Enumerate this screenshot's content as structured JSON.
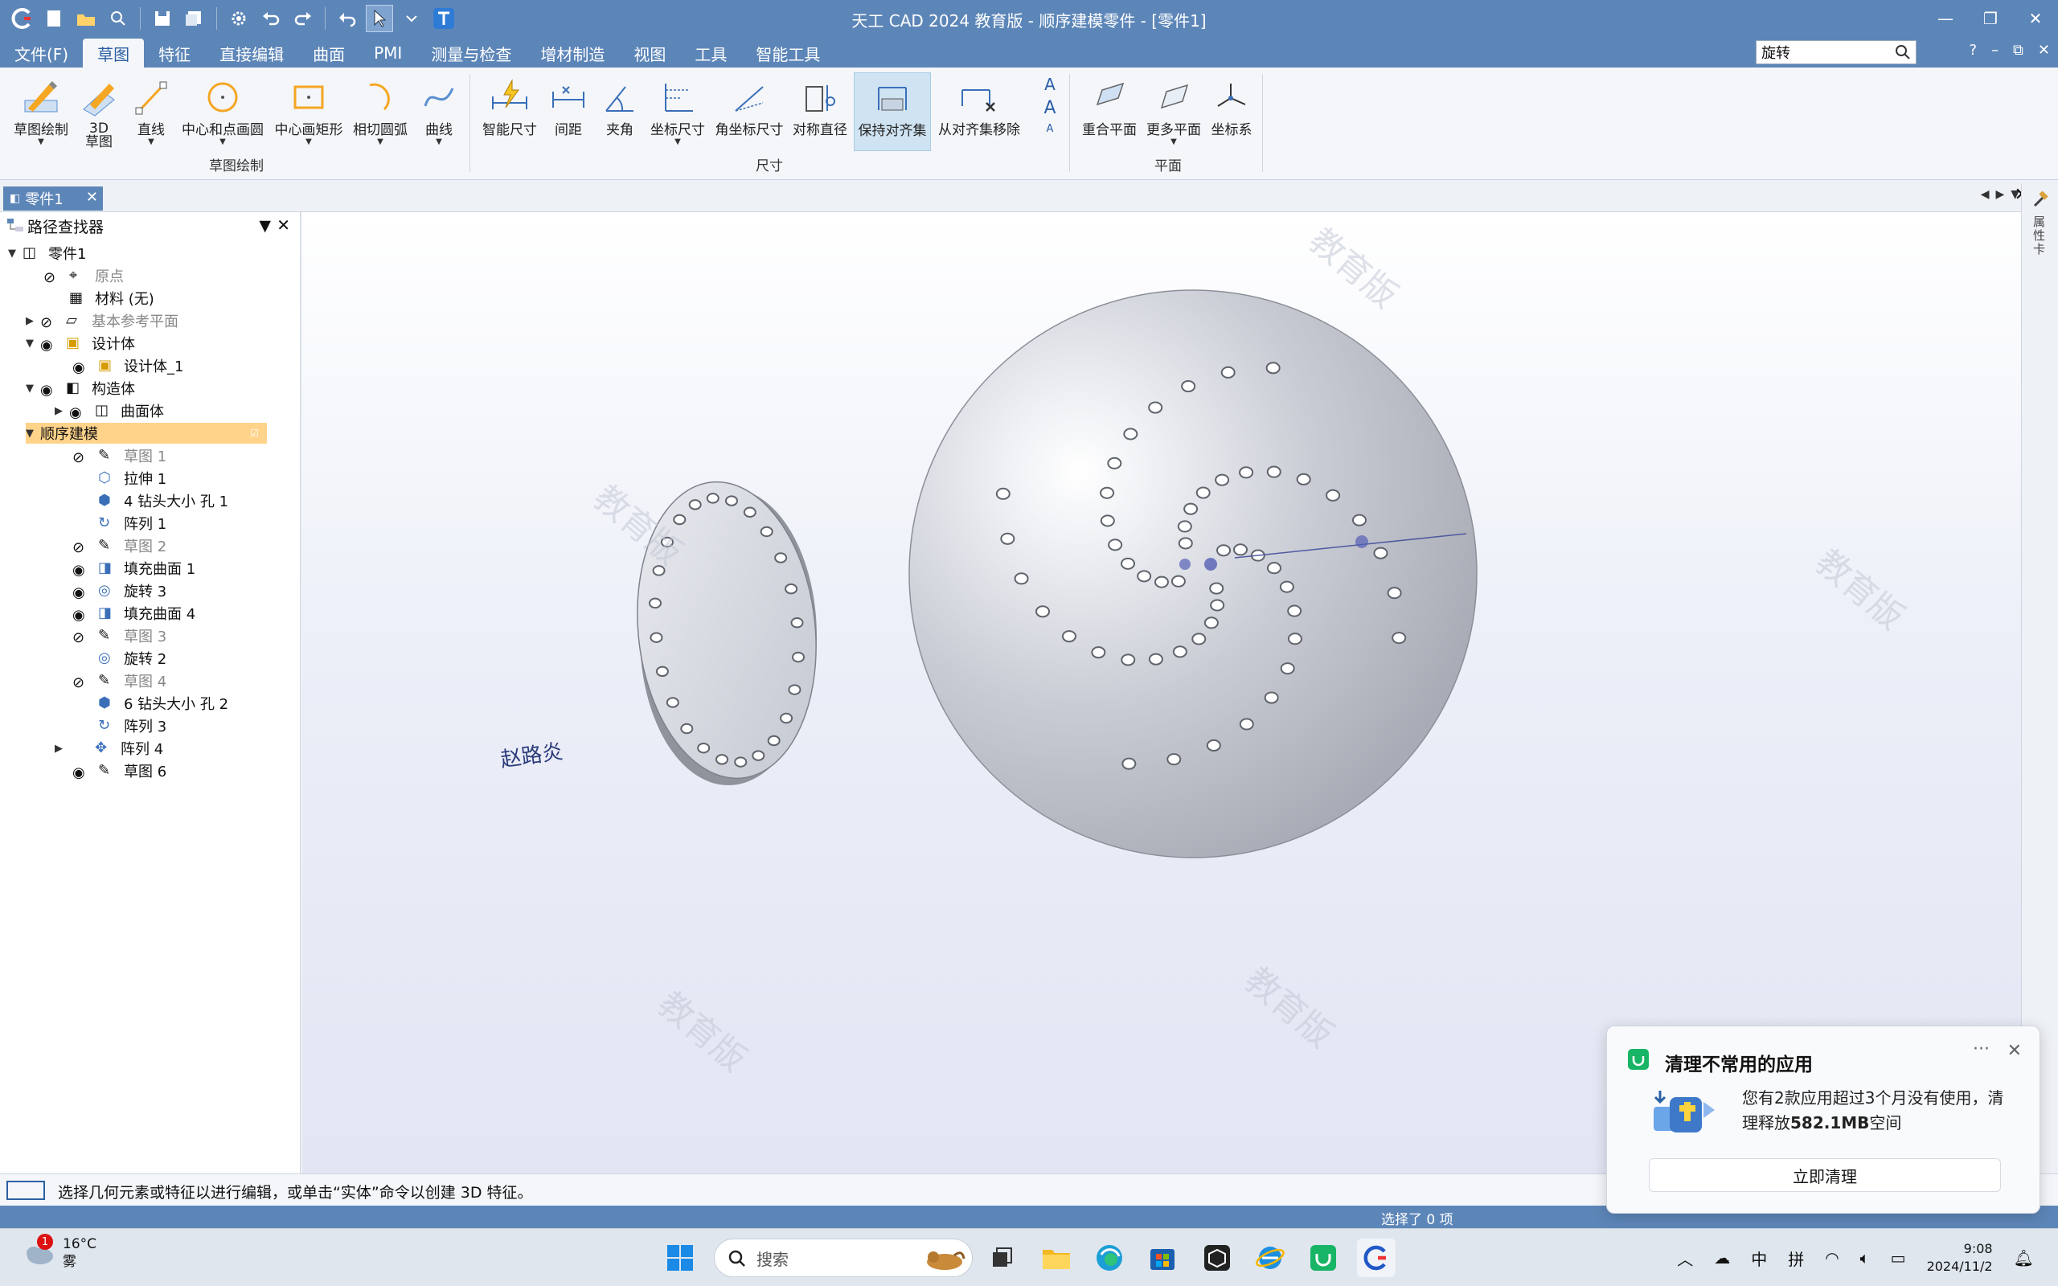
{
  "app": {
    "title": "天工 CAD 2024 教育版 - 顺序建模零件 - [零件1]"
  },
  "menu": {
    "file": "文件(F)",
    "tabs": [
      "草图",
      "特征",
      "直接编辑",
      "曲面",
      "PMI",
      "测量与检查",
      "增材制造",
      "视图",
      "工具",
      "智能工具"
    ],
    "active_tab": "草图",
    "search_value": "旋转",
    "help": "?"
  },
  "ribbon": {
    "buttons": {
      "sketch_draw": "草图绘制",
      "sketch_3d_a": "3D",
      "sketch_3d_b": "草图",
      "line": "直线",
      "center_circle": "中心和点画圆",
      "center_rect": "中心画矩形",
      "tangent_arc": "相切圆弧",
      "curve": "曲线",
      "smart_dim": "智能尺寸",
      "distance": "间距",
      "angle": "夹角",
      "coord_dim": "坐标尺寸",
      "angle_coord_dim": "角坐标尺寸",
      "sym_diameter": "对称直径",
      "keep_align": "保持对齐集",
      "remove_align": "从对齐集移除",
      "coincident_plane": "重合平面",
      "more_planes": "更多平面",
      "coord_sys": "坐标系"
    },
    "groups": {
      "sketch": "草图绘制",
      "dimension": "尺寸",
      "plane": "平面"
    }
  },
  "doc_tab": {
    "label": "零件1"
  },
  "pathfinder": {
    "title": "路径查找器",
    "nodes": {
      "part1": "零件1",
      "origin": "原点",
      "material": "材料 (无)",
      "base_planes": "基本参考平面",
      "design_body": "设计体",
      "design_body_1": "设计体_1",
      "construction": "构造体",
      "surface_body": "曲面体",
      "ordered": "顺序建模",
      "sketch1": "草图 1",
      "extrude1": "拉伸 1",
      "hole1": "4 钻头大小 孔 1",
      "pattern1": "阵列 1",
      "sketch2": "草图 2",
      "fill1": "填充曲面 1",
      "rev3": "旋转 3",
      "fill4": "填充曲面 4",
      "sketch3": "草图 3",
      "rev2": "旋转 2",
      "sketch4": "草图 4",
      "hole2": "6 钻头大小 孔 2",
      "pattern3": "阵列 3",
      "pattern4": "阵列 4",
      "sketch6": "草图 6"
    }
  },
  "viewport": {
    "author": "赵路炎",
    "watermark": "教育版"
  },
  "right_strip": {
    "label": "属性卡"
  },
  "status": {
    "prompt": "选择几何元素或特征以进行编辑，或单击“实体”命令以创建 3D 特征。",
    "selection": "选择了 0 项"
  },
  "taskbar": {
    "weather_temp": "16°C",
    "weather_desc": "雾",
    "weather_badge": "1",
    "search_placeholder": "搜索",
    "ime_lang": "中",
    "ime_mode": "拼",
    "time": "9:08",
    "date": "2024/11/2"
  },
  "toast": {
    "title": "清理不常用的应用",
    "body_a": "您有2款应用超过3个月没有使用，清理释放",
    "body_size": "582.1MB",
    "body_b": "空间",
    "button": "立即清理",
    "more": "···",
    "close": "✕"
  },
  "colors": {
    "titlebar": "#5d86b8",
    "ribbon_bg": "#f4f6fa",
    "selected_node": "#ffd38a",
    "accent": "#2b5fa3"
  }
}
